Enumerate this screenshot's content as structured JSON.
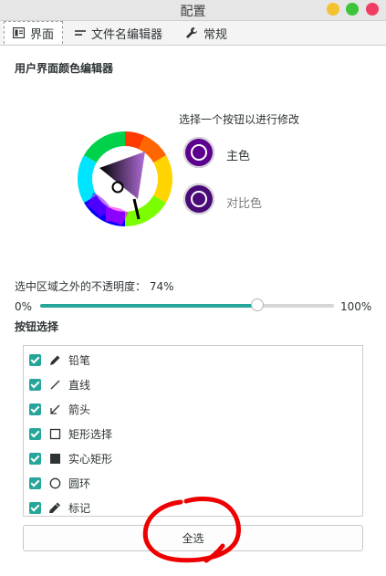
{
  "window": {
    "title": "配置"
  },
  "tabs": [
    {
      "label": "界面",
      "icon": "interface-icon",
      "active": true
    },
    {
      "label": "文件名编辑器",
      "icon": "text-lines-icon",
      "active": false
    },
    {
      "label": "常规",
      "icon": "wrench-icon",
      "active": false
    }
  ],
  "color_editor": {
    "section_title": "用户界面颜色编辑器",
    "prompt": "选择一个按钮以进行修改",
    "main_color": {
      "label": "主色",
      "color": "#5e008f"
    },
    "contrast_color": {
      "label": "对比色",
      "color": "#4a0a78"
    }
  },
  "opacity": {
    "label": "选中区域之外的不透明度：",
    "value": "74%",
    "min_label": "0%",
    "max_label": "100%",
    "fraction": 0.74,
    "accent": "#26a69a"
  },
  "button_selection": {
    "section_title": "按钮选择",
    "items": [
      {
        "label": "铅笔",
        "icon": "pencil-icon",
        "checked": true
      },
      {
        "label": "直线",
        "icon": "line-icon",
        "checked": true
      },
      {
        "label": "箭头",
        "icon": "arrow-icon",
        "checked": true
      },
      {
        "label": "矩形选择",
        "icon": "rectangle-outline-icon",
        "checked": true
      },
      {
        "label": "实心矩形",
        "icon": "rectangle-filled-icon",
        "checked": true
      },
      {
        "label": "圆环",
        "icon": "circle-outline-icon",
        "checked": true
      },
      {
        "label": "标记",
        "icon": "marker-icon",
        "checked": true
      }
    ],
    "select_all_label": "全选"
  }
}
